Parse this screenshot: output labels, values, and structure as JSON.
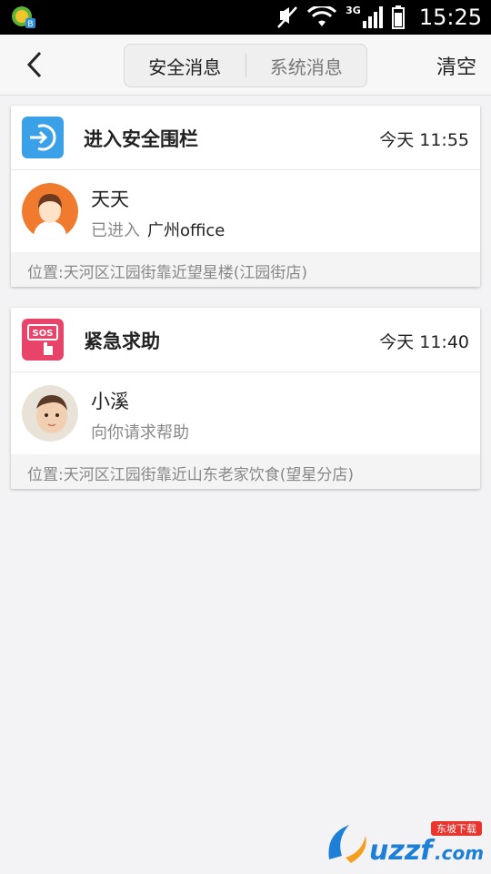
{
  "status_bar": {
    "time": "15:25",
    "network": "3G"
  },
  "header": {
    "tabs": [
      {
        "label": "安全消息"
      },
      {
        "label": "系统消息"
      }
    ],
    "clear_label": "清空"
  },
  "messages": [
    {
      "type": "enter-fence",
      "title": "进入安全围栏",
      "time": "今天 11:55",
      "user": "天天",
      "status_prefix": "已进入",
      "status_value": "广州office",
      "location": "位置:天河区江园街靠近望星楼(江园街店)",
      "icon": "enter-fence-icon",
      "icon_color": "#3aa0e8"
    },
    {
      "type": "sos",
      "title": "紧急求助",
      "time": "今天 11:40",
      "user": "小溪",
      "status_prefix": "向你请求帮助",
      "location": "位置:天河区江园街靠近山东老家饮食(望星分店)",
      "icon": "sos-icon",
      "icon_color": "#e8446a"
    }
  ],
  "watermark": {
    "text": "uzzf.com",
    "tagline": "东坡下载"
  }
}
